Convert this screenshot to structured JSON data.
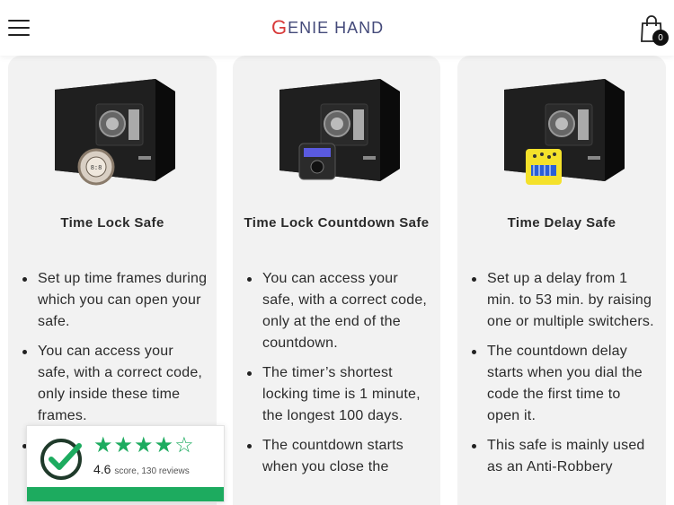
{
  "header": {
    "logo": {
      "first_letter": "G",
      "rest": "ENIE HAND"
    },
    "menu_icon": "hamburger-icon",
    "cart_icon": "shopping-bag-icon",
    "cart_count": "0"
  },
  "cards": [
    {
      "title": "Time Lock Safe",
      "accessory": "time-lock-dial",
      "features": [
        "Set up time frames during which you can open your safe.",
        "You can access your safe, with a correct code, only inside these time frames.",
        ""
      ]
    },
    {
      "title": "Time Lock Countdown Safe",
      "accessory": "countdown-timer-keypad",
      "features": [
        "You can access your safe, with a correct code, only at the end of the countdown.",
        "The timer’s shortest locking time is 1 minute, the longest 100 days.",
        "The countdown starts when you close the"
      ]
    },
    {
      "title": "Time Delay Safe",
      "accessory": "dip-switch-module",
      "features": [
        "Set up a delay from 1 min. to 53 min. by raising one or multiple switchers.",
        "The countdown delay starts when you dial the code the first time to open it.",
        "This safe is mainly used as an Anti-Robbery"
      ]
    }
  ],
  "review_widget": {
    "rating": "4.6",
    "score_label": "score, 130 reviews",
    "stars": 4.5,
    "brand_color": "#1dab5f"
  },
  "colors": {
    "card_bg": "#f2f2f2",
    "logo_red": "#d83a3a",
    "logo_blue": "#444a7a"
  }
}
